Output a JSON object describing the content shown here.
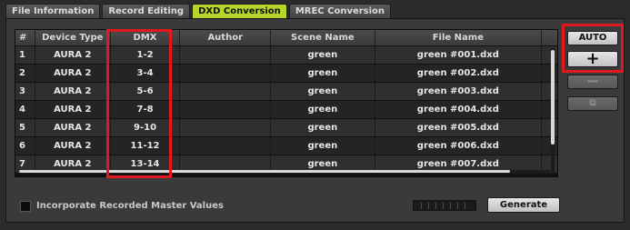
{
  "tabs": [
    {
      "label": "File Information",
      "active": false
    },
    {
      "label": "Record Editing",
      "active": false
    },
    {
      "label": "DXD Conversion",
      "active": true
    },
    {
      "label": "MREC Conversion",
      "active": false
    }
  ],
  "table": {
    "headers": {
      "num": "#",
      "device_type": "Device Type",
      "dmx": "DMX",
      "author": "Author",
      "scene_name": "Scene Name",
      "file_name": "File Name"
    },
    "rows": [
      {
        "num": "1",
        "device_type": "AURA 2",
        "dmx": "1-2",
        "author": "",
        "scene_name": "green",
        "file_name": "green #001.dxd"
      },
      {
        "num": "2",
        "device_type": "AURA 2",
        "dmx": "3-4",
        "author": "",
        "scene_name": "green",
        "file_name": "green #002.dxd"
      },
      {
        "num": "3",
        "device_type": "AURA 2",
        "dmx": "5-6",
        "author": "",
        "scene_name": "green",
        "file_name": "green #003.dxd"
      },
      {
        "num": "4",
        "device_type": "AURA 2",
        "dmx": "7-8",
        "author": "",
        "scene_name": "green",
        "file_name": "green #004.dxd"
      },
      {
        "num": "5",
        "device_type": "AURA 2",
        "dmx": "9-10",
        "author": "",
        "scene_name": "green",
        "file_name": "green #005.dxd"
      },
      {
        "num": "6",
        "device_type": "AURA 2",
        "dmx": "11-12",
        "author": "",
        "scene_name": "green",
        "file_name": "green #006.dxd"
      },
      {
        "num": "7",
        "device_type": "AURA 2",
        "dmx": "13-14",
        "author": "",
        "scene_name": "green",
        "file_name": "green #007.dxd"
      }
    ]
  },
  "side_buttons": {
    "auto_label": "AUTO",
    "add_label": "+",
    "add_icon": "plus-icon",
    "remove_label": "−",
    "remove_icon": "minus-icon",
    "copy_label": "⧉",
    "copy_icon": "copy-icon"
  },
  "footer": {
    "checkbox_label": "Incorporate Recorded Master Values",
    "checkbox_checked": false,
    "progress_fraction": 0,
    "generate_label": "Generate"
  },
  "colors": {
    "accent": "#b6d62c",
    "highlight": "#e3171e",
    "panel_bg": "#3a3a3a"
  }
}
